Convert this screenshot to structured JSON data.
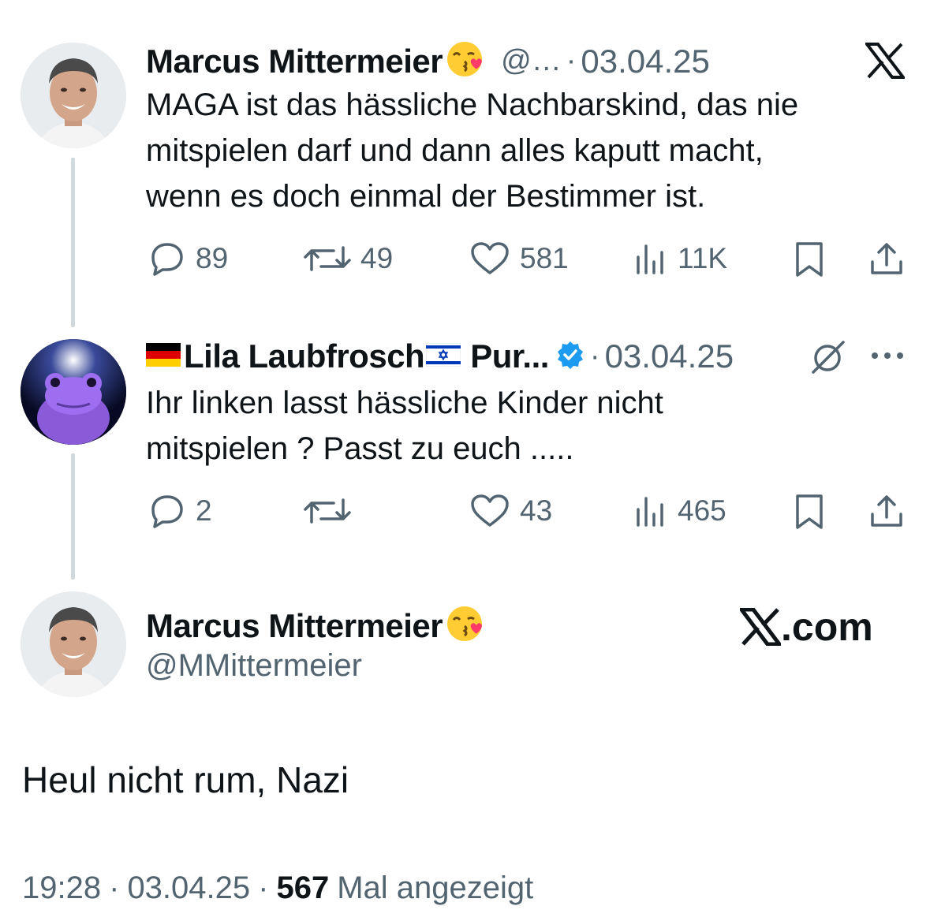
{
  "tweet1": {
    "display_name": "Marcus Mittermeier",
    "handle": "@…",
    "date": "03.04.25",
    "text_lines": [
      "MAGA ist das hässliche Nachbarskind, das nie",
      "mitspielen darf und dann alles kaputt macht,",
      "wenn es doch einmal der Bestimmer ist."
    ],
    "stats": {
      "replies": "89",
      "reposts": "49",
      "likes": "581",
      "views": "11K"
    }
  },
  "tweet2": {
    "display_name": "Lila Laubfrosch",
    "name_suffix": "Pur...",
    "date": "03.04.25",
    "text_lines": [
      "Ihr linken lasst hässliche Kinder nicht",
      "mitspielen ? Passt zu euch ....."
    ],
    "stats": {
      "replies": "2",
      "reposts": "",
      "likes": "43",
      "views": "465"
    }
  },
  "main_tweet": {
    "display_name": "Marcus Mittermeier",
    "handle": "@MMittermeier",
    "brand": ".com",
    "text": "Heul nicht rum, Nazi",
    "time": "19:28",
    "date": "03.04.25",
    "views": "567",
    "views_label": "Mal angezeigt"
  },
  "colors": {
    "text": "#0f1419",
    "muted": "#536471",
    "thread_line": "#cfd9de",
    "verified": "#1d9bf0"
  },
  "icons": [
    "x-logo-icon",
    "reply-icon",
    "repost-icon",
    "like-icon",
    "views-icon",
    "bookmark-icon",
    "share-icon",
    "verified-badge-icon",
    "grok-icon",
    "more-icon",
    "kiss-emoji-icon",
    "germany-flag-icon",
    "israel-flag-icon"
  ]
}
